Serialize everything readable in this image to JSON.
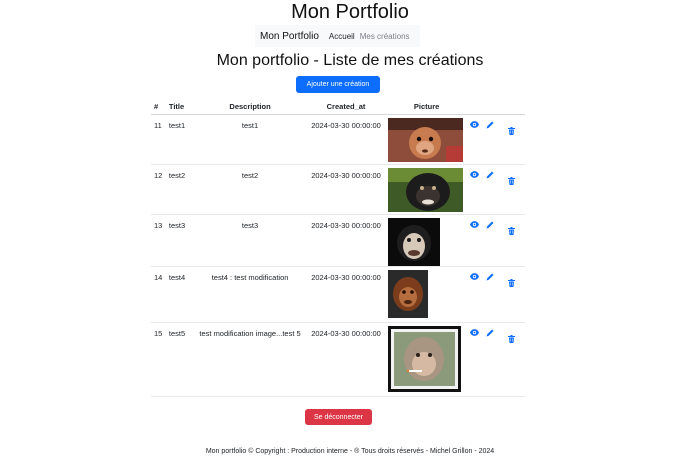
{
  "header": {
    "site_title": "Mon Portfolio"
  },
  "navbar": {
    "brand": "Mon Portfolio",
    "links": [
      "Accueil",
      "Mes créations"
    ]
  },
  "main": {
    "page_title": "Mon portfolio - Liste de mes créations",
    "add_button": "Ajouter une création",
    "columns": [
      "#",
      "Title",
      "Description",
      "Created_at",
      "Picture"
    ],
    "rows": [
      {
        "id": "11",
        "title": "test1",
        "description": "test1",
        "created_at": "2024-03-30 00:00:00",
        "picture": "baby-orangutan"
      },
      {
        "id": "12",
        "title": "test2",
        "description": "test2",
        "created_at": "2024-03-30 00:00:00",
        "picture": "gorilla"
      },
      {
        "id": "13",
        "title": "test3",
        "description": "test3",
        "created_at": "2024-03-30 00:00:00",
        "picture": "chimpanzee"
      },
      {
        "id": "14",
        "title": "test4",
        "description": "test4 : test modification",
        "created_at": "2024-03-30 00:00:00",
        "picture": "young-orangutan"
      },
      {
        "id": "15",
        "title": "test5",
        "description": "test modification image...test 5",
        "created_at": "2024-03-30 00:00:00",
        "picture": "macaque-framed"
      }
    ],
    "logout_button": "Se déconnecter"
  },
  "footer": {
    "text": "Mon portfolio © Copyright : Production interne - ® Tous droits réservés - Michel Grillon - 2024"
  },
  "colors": {
    "primary": "#0d6efd",
    "danger": "#dc3545",
    "navbar_bg": "#f8f9fa"
  },
  "icons": {
    "view": "eye-icon",
    "edit": "pencil-icon",
    "delete": "trash-icon"
  }
}
